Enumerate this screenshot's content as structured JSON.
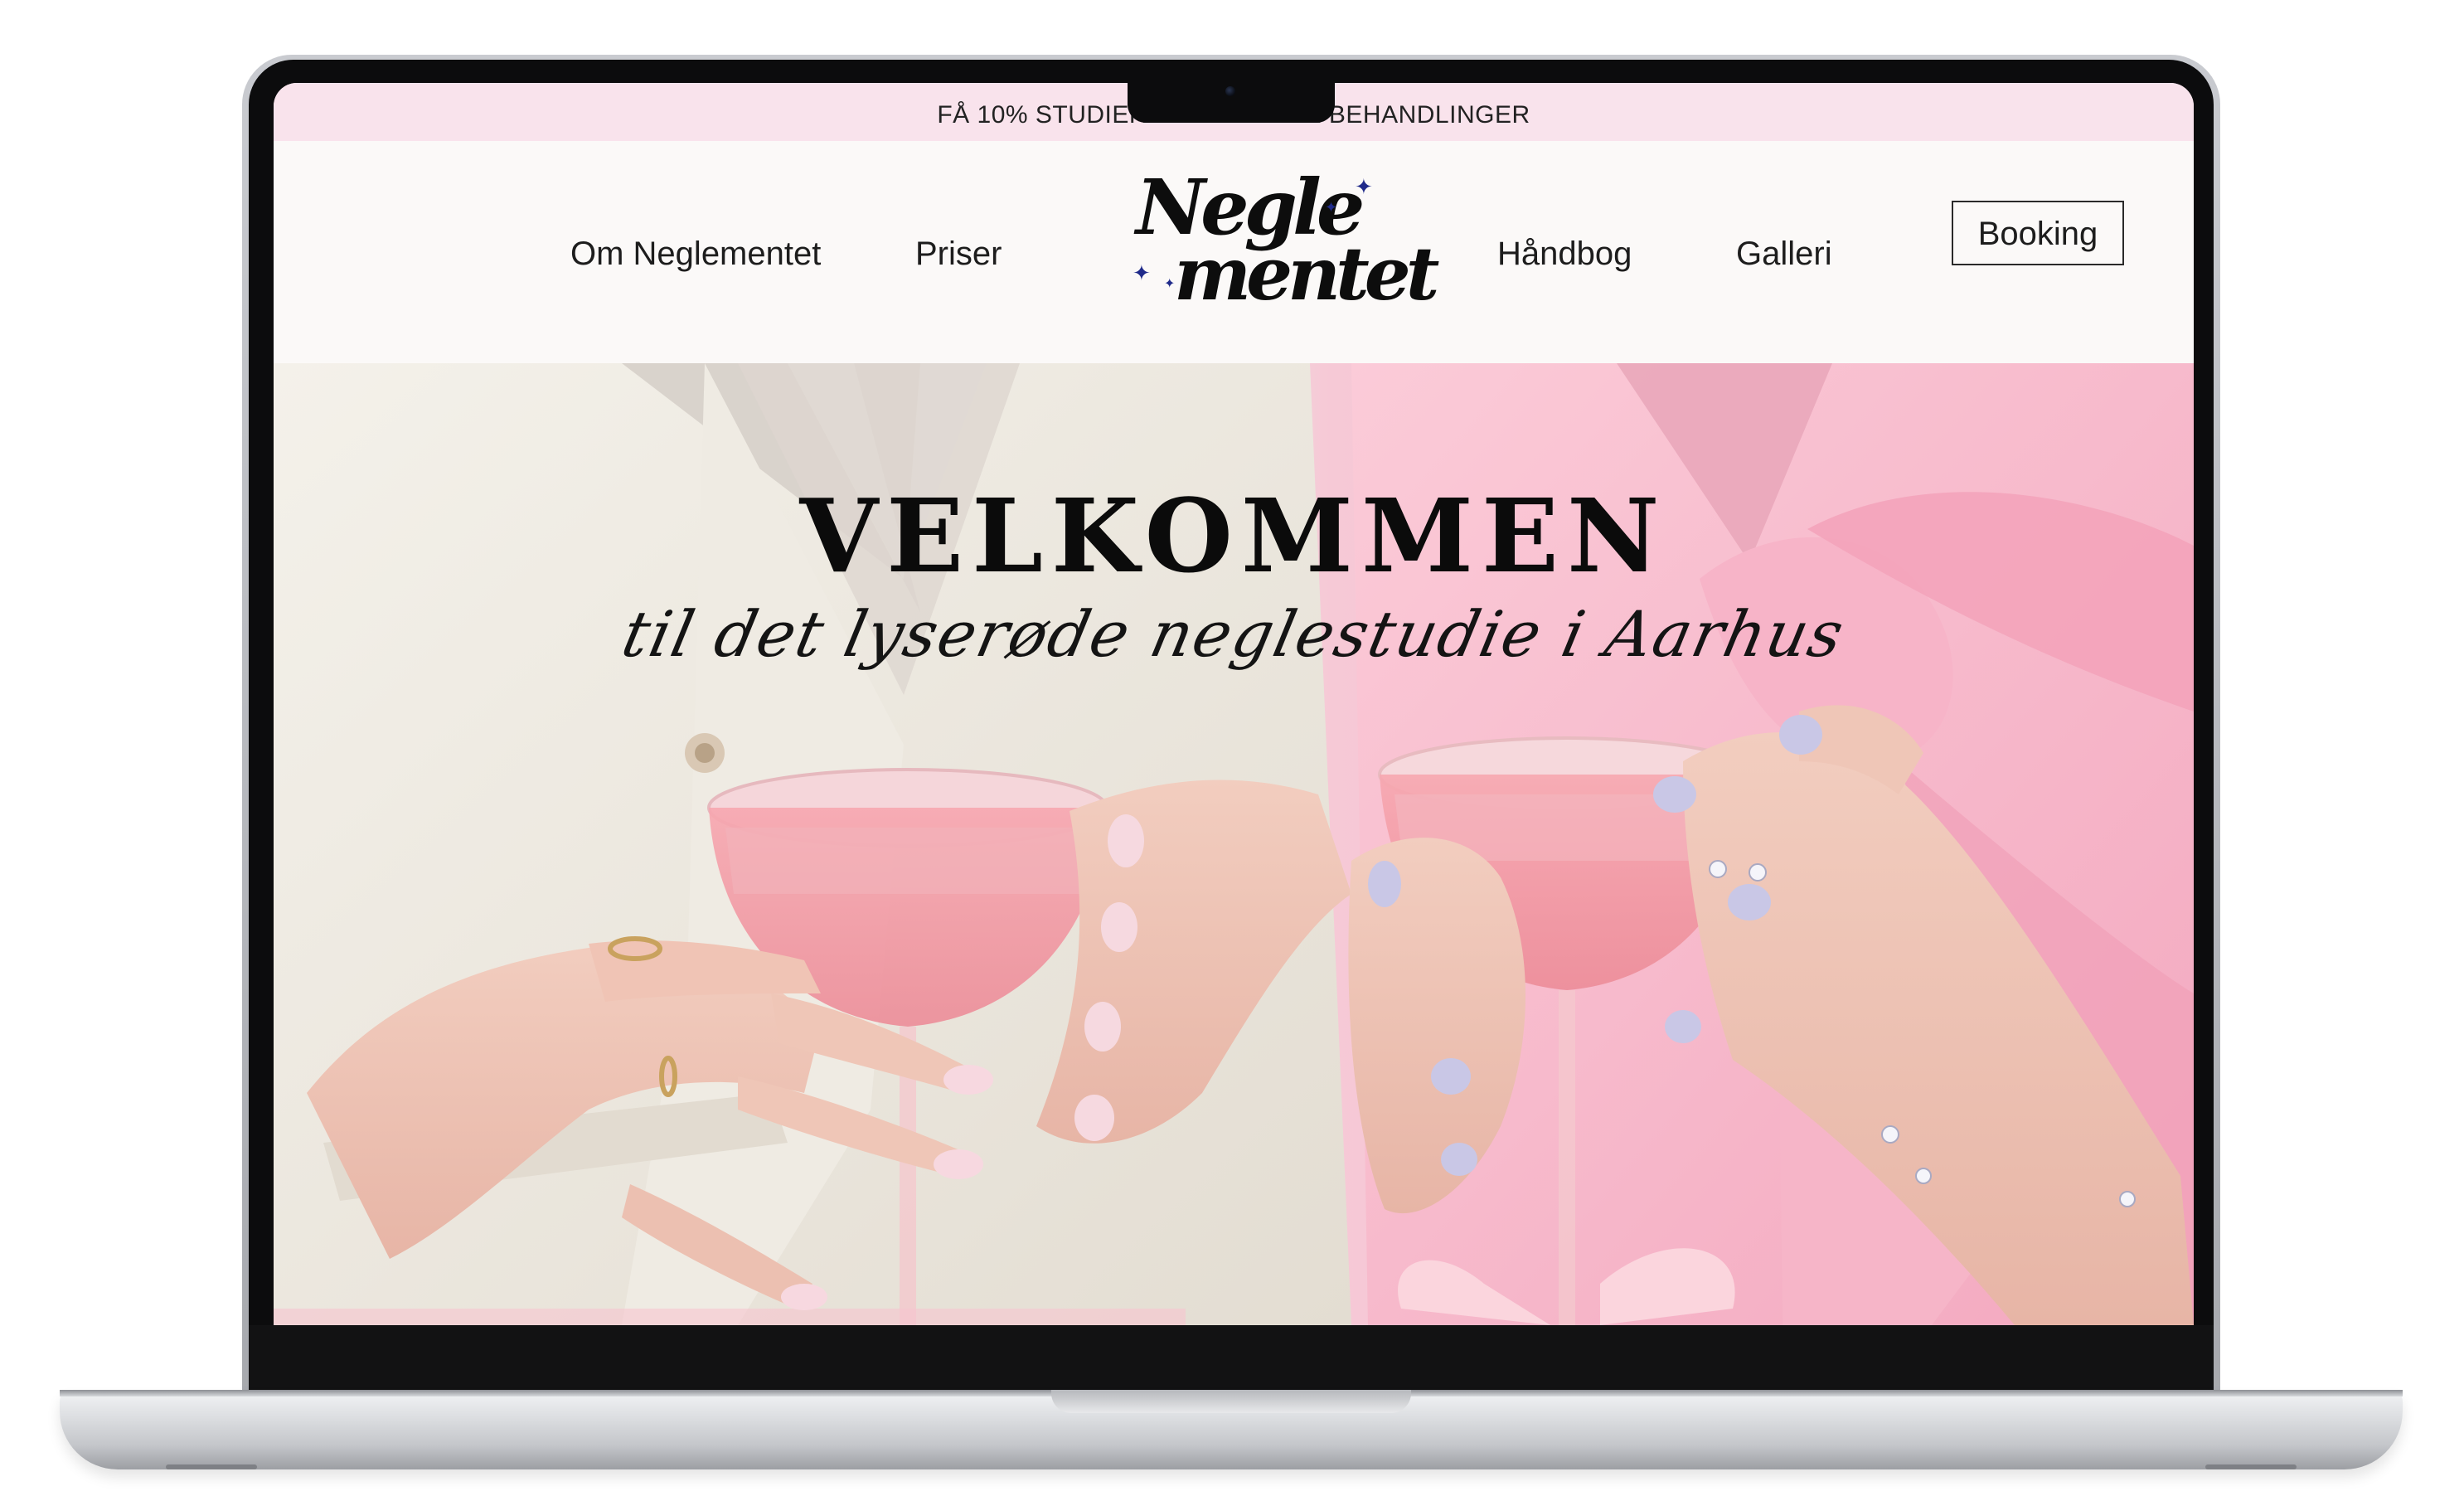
{
  "promo": {
    "text": "FÅ 10% STUDIERABAT PÅ ALLE BEHANDLINGER"
  },
  "nav": {
    "items": [
      {
        "label": "Om Neglementet"
      },
      {
        "label": "Priser"
      },
      {
        "label": "Håndbog"
      },
      {
        "label": "Galleri"
      }
    ],
    "booking_label": "Booking"
  },
  "logo": {
    "line1": "Negle",
    "line2": "mentet"
  },
  "hero": {
    "title": "VELKOMMEN",
    "subtitle": "til det lyserøde neglestudie i Aarhus"
  },
  "colors": {
    "promo_bg": "#f9e3ec",
    "header_bg": "#fbf9f8",
    "text": "#1d1d1d",
    "booking_border": "#2a2a2a",
    "sparkle": "#1f2a8a"
  },
  "icons": {
    "logo_decoration": "sparkle-icon",
    "camera": "camera-icon"
  }
}
